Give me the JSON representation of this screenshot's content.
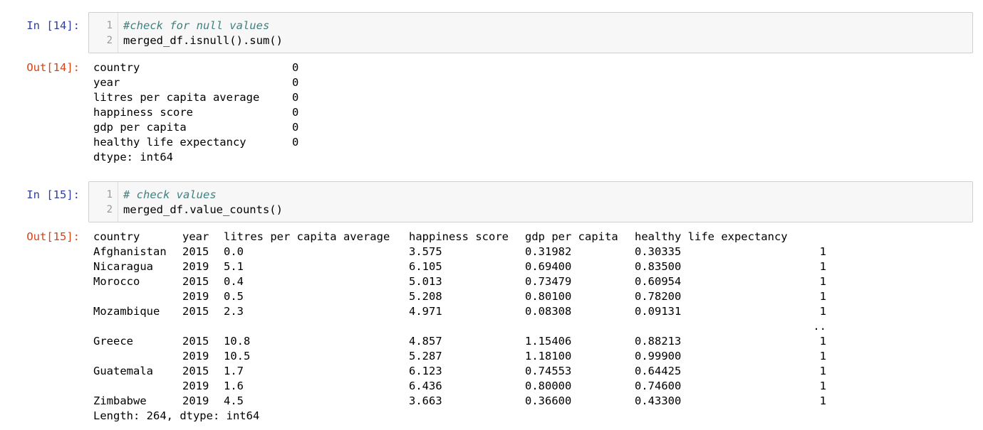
{
  "cells": [
    {
      "in_prompt": "In [14]:",
      "out_prompt": "Out[14]:",
      "code": [
        {
          "num": "1",
          "text": "#check for null values",
          "comment": true
        },
        {
          "num": "2",
          "text": "merged_df.isnull().sum()",
          "comment": false
        }
      ],
      "output_rows": [
        {
          "name": "country",
          "value": "0"
        },
        {
          "name": "year",
          "value": "0"
        },
        {
          "name": "litres per capita average",
          "value": "0"
        },
        {
          "name": "happiness score",
          "value": "0"
        },
        {
          "name": "gdp per capita",
          "value": "0"
        },
        {
          "name": "healthy life expectancy",
          "value": "0"
        }
      ],
      "output_footer": "dtype: int64"
    },
    {
      "in_prompt": "In [15]:",
      "out_prompt": "Out[15]:",
      "code": [
        {
          "num": "1",
          "text": "# check values",
          "comment": true
        },
        {
          "num": "2",
          "text": "merged_df.value_counts()",
          "comment": false
        }
      ],
      "table_headers": [
        "country",
        "year",
        "litres per capita average",
        "happiness score",
        "gdp per capita",
        "healthy life expectancy"
      ],
      "table_rows": [
        {
          "country": "Afghanistan",
          "year": "2015",
          "litres": "0.0",
          "happiness": "3.575",
          "gdp": "0.31982",
          "life": "0.30335",
          "count": "1"
        },
        {
          "country": "Nicaragua",
          "year": "2019",
          "litres": "5.1",
          "happiness": "6.105",
          "gdp": "0.69400",
          "life": "0.83500",
          "count": "1"
        },
        {
          "country": "Morocco",
          "year": "2015",
          "litres": "0.4",
          "happiness": "5.013",
          "gdp": "0.73479",
          "life": "0.60954",
          "count": "1"
        },
        {
          "country": "",
          "year": "2019",
          "litres": "0.5",
          "happiness": "5.208",
          "gdp": "0.80100",
          "life": "0.78200",
          "count": "1"
        },
        {
          "country": "Mozambique",
          "year": "2015",
          "litres": "2.3",
          "happiness": "4.971",
          "gdp": "0.08308",
          "life": "0.09131",
          "count": "1"
        },
        {
          "country": "",
          "year": "",
          "litres": "",
          "happiness": "",
          "gdp": "",
          "life": "",
          "count": ".."
        },
        {
          "country": "Greece",
          "year": "2015",
          "litres": "10.8",
          "happiness": "4.857",
          "gdp": "1.15406",
          "life": "0.88213",
          "count": "1"
        },
        {
          "country": "",
          "year": "2019",
          "litres": "10.5",
          "happiness": "5.287",
          "gdp": "1.18100",
          "life": "0.99900",
          "count": "1"
        },
        {
          "country": "Guatemala",
          "year": "2015",
          "litres": "1.7",
          "happiness": "6.123",
          "gdp": "0.74553",
          "life": "0.64425",
          "count": "1"
        },
        {
          "country": "",
          "year": "2019",
          "litres": "1.6",
          "happiness": "6.436",
          "gdp": "0.80000",
          "life": "0.74600",
          "count": "1"
        },
        {
          "country": "Zimbabwe",
          "year": "2019",
          "litres": "4.5",
          "happiness": "3.663",
          "gdp": "0.36600",
          "life": "0.43300",
          "count": "1"
        }
      ],
      "output_footer": "Length: 264, dtype: int64"
    }
  ]
}
